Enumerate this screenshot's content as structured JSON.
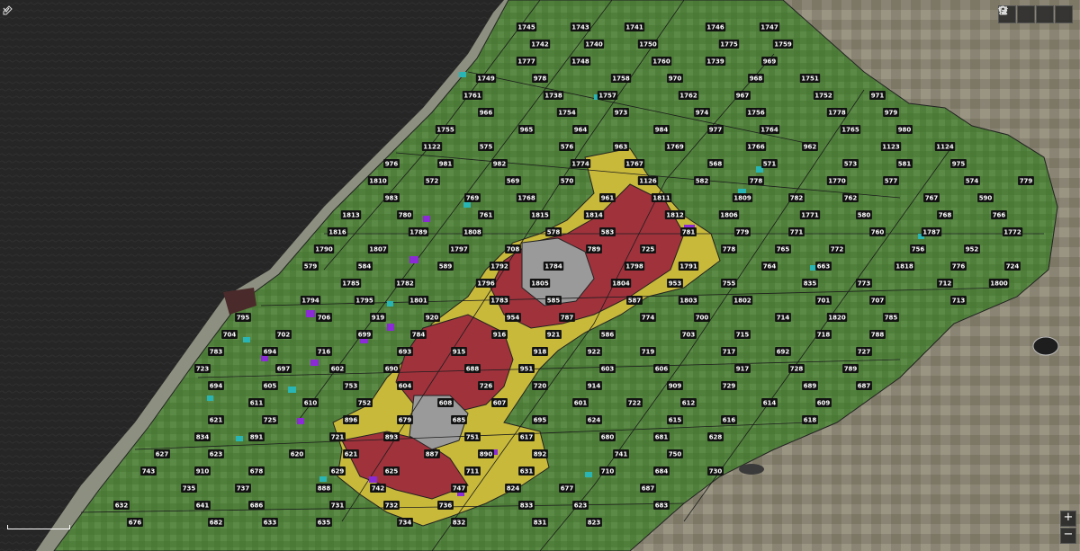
{
  "map": {
    "colors": {
      "sea": "#2a2a2a",
      "land_green": "#4e7d3a",
      "yellow": "#c8b93b",
      "red": "#a0323c",
      "gray": "#9a9a9a",
      "purple": "#8a2bd6",
      "cyan": "#2ab5b5",
      "farmland": "#8a8474"
    },
    "block_labels": [
      "1745",
      "1743",
      "1741",
      "1746",
      "1747",
      "1742",
      "1740",
      "1750",
      "1775",
      "1759",
      "1777",
      "1748",
      "1760",
      "1739",
      "969",
      "1749",
      "978",
      "1758",
      "970",
      "968",
      "1751",
      "1761",
      "1738",
      "1757",
      "1762",
      "967",
      "1752",
      "971",
      "966",
      "1754",
      "973",
      "974",
      "1756",
      "1778",
      "979",
      "1755",
      "965",
      "964",
      "984",
      "977",
      "1764",
      "1765",
      "980",
      "1122",
      "575",
      "576",
      "963",
      "1769",
      "1766",
      "962",
      "1123",
      "1124",
      "976",
      "981",
      "982",
      "1774",
      "1767",
      "568",
      "571",
      "573",
      "581",
      "975",
      "1810",
      "572",
      "569",
      "570",
      "1126",
      "582",
      "778",
      "1770",
      "577",
      "574",
      "779",
      "983",
      "769",
      "1768",
      "961",
      "1811",
      "1809",
      "782",
      "762",
      "767",
      "590",
      "1813",
      "780",
      "761",
      "1815",
      "1814",
      "1812",
      "1806",
      "1771",
      "580",
      "768",
      "766",
      "1816",
      "1789",
      "1808",
      "578",
      "583",
      "781",
      "779",
      "771",
      "760",
      "1787",
      "1772",
      "1790",
      "1807",
      "1797",
      "708",
      "789",
      "725",
      "778",
      "765",
      "772",
      "756",
      "952",
      "579",
      "584",
      "589",
      "1792",
      "1784",
      "1798",
      "1791",
      "764",
      "663",
      "1818",
      "776",
      "724",
      "1785",
      "1782",
      "1796",
      "1805",
      "1804",
      "953",
      "755",
      "835",
      "773",
      "712",
      "1800",
      "1794",
      "1795",
      "1801",
      "1783",
      "585",
      "587",
      "1803",
      "1802",
      "701",
      "707",
      "713",
      "795",
      "706",
      "919",
      "920",
      "954",
      "787",
      "774",
      "700",
      "714",
      "1820",
      "785",
      "704",
      "702",
      "699",
      "784",
      "916",
      "921",
      "586",
      "703",
      "715",
      "718",
      "788",
      "783",
      "694",
      "716",
      "693",
      "915",
      "918",
      "922",
      "719",
      "717",
      "692",
      "727",
      "723",
      "697",
      "602",
      "690",
      "688",
      "951",
      "603",
      "606",
      "917",
      "728",
      "789",
      "694",
      "605",
      "753",
      "604",
      "726",
      "720",
      "914",
      "909",
      "729",
      "689",
      "687",
      "611",
      "610",
      "752",
      "608",
      "607",
      "601",
      "722",
      "612",
      "614",
      "609",
      "621",
      "725",
      "896",
      "679",
      "685",
      "695",
      "624",
      "615",
      "616",
      "618",
      "834",
      "891",
      "721",
      "893",
      "751",
      "617",
      "680",
      "681",
      "628",
      "627",
      "623",
      "620",
      "621",
      "887",
      "890",
      "892",
      "741",
      "750",
      "743",
      "910",
      "678",
      "629",
      "625",
      "711",
      "631",
      "710",
      "684",
      "730",
      "735",
      "737",
      "888",
      "742",
      "747",
      "824",
      "677",
      "687",
      "632",
      "641",
      "686",
      "731",
      "732",
      "736",
      "833",
      "623",
      "683",
      "676",
      "682",
      "633",
      "635",
      "734",
      "832",
      "831",
      "823"
    ],
    "scale_label": ""
  },
  "toolbar": {
    "icons": [
      "search-icon",
      "home-icon",
      "legend-icon",
      "layers-icon"
    ]
  }
}
